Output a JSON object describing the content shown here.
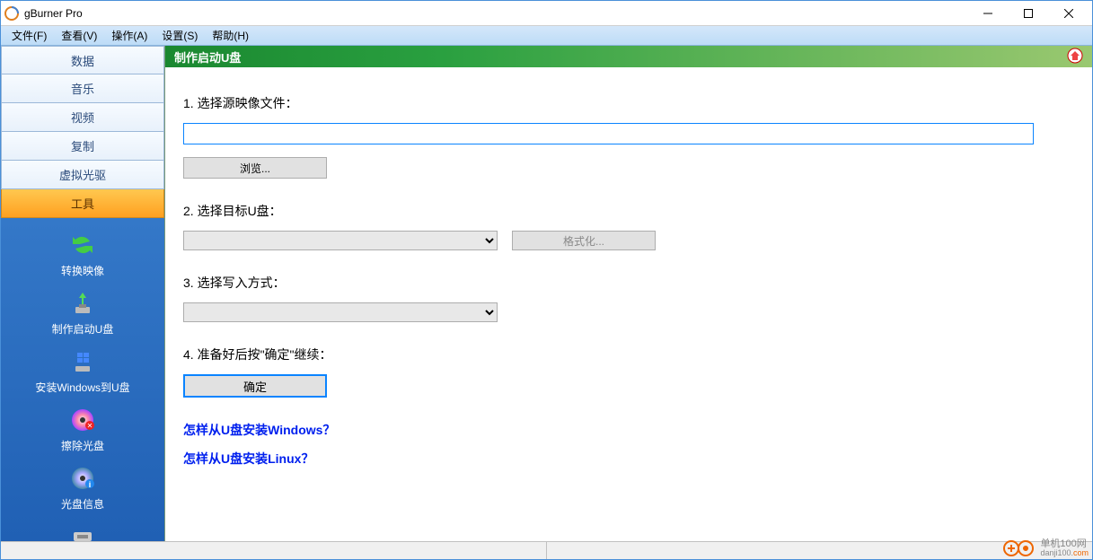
{
  "window": {
    "title": "gBurner Pro"
  },
  "menubar": [
    "文件(F)",
    "查看(V)",
    "操作(A)",
    "设置(S)",
    "帮助(H)"
  ],
  "sidebar": {
    "tabs": [
      "数据",
      "音乐",
      "视频",
      "复制",
      "虚拟光驱",
      "工具"
    ],
    "active_index": 5,
    "tools": [
      {
        "label": "转换映像",
        "icon": "refresh"
      },
      {
        "label": "制作启动U盘",
        "icon": "usb-arrow"
      },
      {
        "label": "安装Windows到U盘",
        "icon": "usb-win"
      },
      {
        "label": "擦除光盘",
        "icon": "disc-erase"
      },
      {
        "label": "光盘信息",
        "icon": "disc-info"
      }
    ]
  },
  "main": {
    "header_title": "制作启动U盘",
    "steps": {
      "s1_label": "1. 选择源映像文件：",
      "path_value": "",
      "browse_label": "浏览...",
      "s2_label": "2. 选择目标U盘：",
      "target_value": "",
      "format_label": "格式化...",
      "s3_label": "3. 选择写入方式：",
      "write_value": "",
      "s4_label": "4. 准备好后按\"确定\"继续：",
      "confirm_label": "确定"
    },
    "links": {
      "l1": "怎样从U盘安装Windows？",
      "l2": "怎样从U盘安装Linux？"
    }
  },
  "watermark": {
    "cn": "单机100网",
    "en_a": "danji100.",
    "en_b": "com"
  }
}
